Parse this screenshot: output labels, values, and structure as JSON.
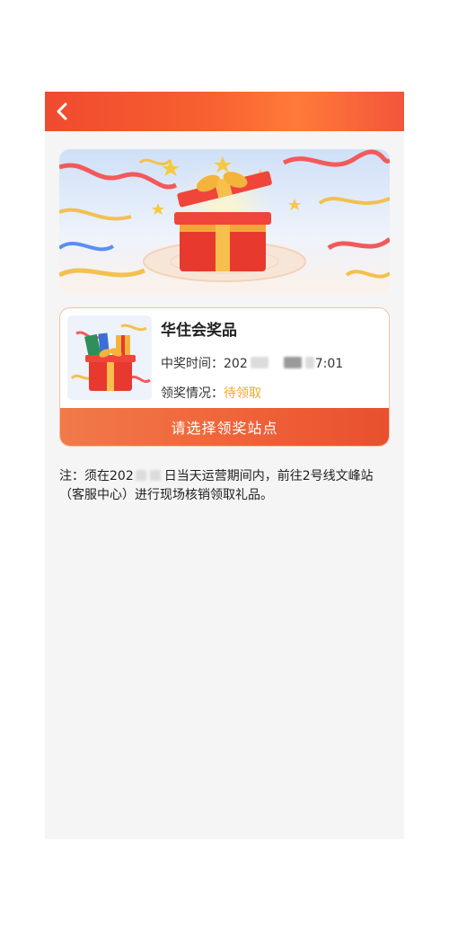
{
  "nav": {
    "back_icon": "chevron-left-icon"
  },
  "banner": {
    "image": "gift-box-celebration-banner"
  },
  "prize": {
    "thumbnail": "gift-box-thumbnail",
    "title": "华住会奖品",
    "time_label": "中奖时间：",
    "time_value_prefix": "202",
    "time_value_suffix": "7:01",
    "status_label": "领奖情况：",
    "status_value": "待领取",
    "action_label": "请选择领奖站点"
  },
  "note": {
    "part1": "注：须在202",
    "part2": "日当天运营期间内，前往2号线文峰站（客服中心）进行现场核销领取礼品。"
  },
  "colors": {
    "nav_gradient_start": "#f04a2f",
    "button": "#f0653a",
    "status_pending": "#f5a623",
    "card_border": "#f0c3a8",
    "page_bg": "#f5f5f5"
  }
}
